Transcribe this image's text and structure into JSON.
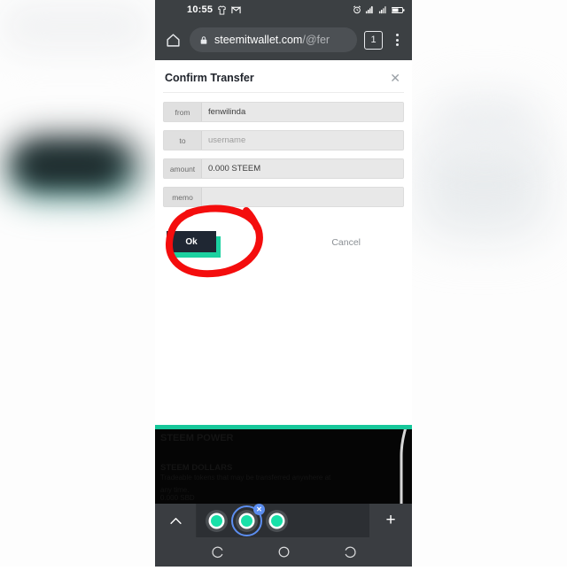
{
  "statusbar": {
    "time": "10:55",
    "icons_left": [
      "shirt-icon",
      "gmail-m-icon"
    ],
    "icons_right": [
      "alarm-icon",
      "signal-1-icon",
      "signal-2-icon",
      "battery-icon"
    ]
  },
  "toolbar": {
    "home_icon": "home-icon",
    "lock_icon": "lock-icon",
    "url_main": "steemitwallet.com",
    "url_path": "/@fer",
    "tab_count": "1",
    "menu_icon": "overflow-menu-icon"
  },
  "dialog": {
    "title": "Confirm Transfer",
    "close_label": "✕",
    "fields": [
      {
        "label": "from",
        "value": "fenwilinda",
        "placeholder": false
      },
      {
        "label": "to",
        "value": "username",
        "placeholder": true
      },
      {
        "label": "amount",
        "value": "0.000 STEEM",
        "placeholder": false
      },
      {
        "label": "memo",
        "value": "",
        "placeholder": true
      }
    ],
    "ok_label": "Ok",
    "cancel_label": "Cancel",
    "annotation": "red-circle-highlight"
  },
  "lower_panel": {
    "ghost_lines": [
      "STEEM POWER",
      "STEEM DOLLARS",
      "Tradeable tokens that may be transferred anywhere at",
      "any time.",
      "0.000 SBD"
    ],
    "chevron_icon": "chevron-up-icon",
    "plus_label": "+",
    "tabs": [
      {
        "name": "browser-tab-1",
        "selected": false,
        "close": false
      },
      {
        "name": "browser-tab-2",
        "selected": true,
        "close": true,
        "close_label": "✕"
      },
      {
        "name": "browser-tab-3",
        "selected": false,
        "close": false
      }
    ],
    "nav": [
      {
        "name": "nav-back-icon"
      },
      {
        "name": "nav-home-icon"
      },
      {
        "name": "nav-recents-icon"
      }
    ]
  },
  "colors": {
    "accent_teal": "#16c79a",
    "annotation_red": "#f40d0d",
    "chrome_dark": "#3c4043",
    "button_dark": "#1f2733",
    "tab_select_blue": "#5c8ef0"
  }
}
